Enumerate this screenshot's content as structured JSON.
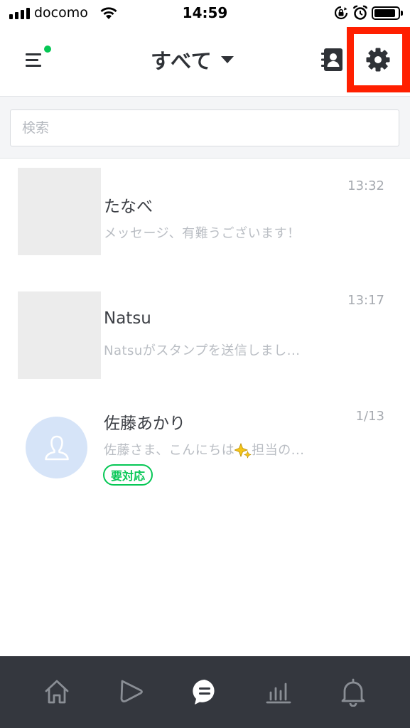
{
  "status_bar": {
    "carrier": "docomo",
    "time": "14:59",
    "battery_level": 0.9
  },
  "header": {
    "filter_label": "すべて",
    "menu_has_notification": true,
    "highlight_color": "#ff1f00"
  },
  "search": {
    "placeholder": "検索",
    "value": ""
  },
  "chats": [
    {
      "name": "たなべ",
      "preview": "メッセージ、有難うございます！",
      "time": "13:32",
      "avatar": "photo"
    },
    {
      "name": "Natsu",
      "preview": "Natsuがスタンプを送信しまし...",
      "time": "13:17",
      "avatar": "photo"
    },
    {
      "name": "佐藤あかり",
      "preview_before_emoji": "佐藤さま、こんにちは",
      "preview_emoji": "sparkles-icon",
      "preview_after_emoji": "担当の...",
      "time": "1/13",
      "avatar": "default-user-icon",
      "badge": "要対応"
    }
  ],
  "bottom_nav": {
    "items": [
      {
        "icon": "home-icon",
        "active": false
      },
      {
        "icon": "voom-play-icon",
        "active": false
      },
      {
        "icon": "chat-bubble-icon",
        "active": true
      },
      {
        "icon": "bar-chart-icon",
        "active": false
      },
      {
        "icon": "bell-icon",
        "active": false
      }
    ]
  },
  "colors": {
    "accent_green": "#06c755",
    "nav_background": "#34373e",
    "highlight_red": "#ff1f00"
  }
}
